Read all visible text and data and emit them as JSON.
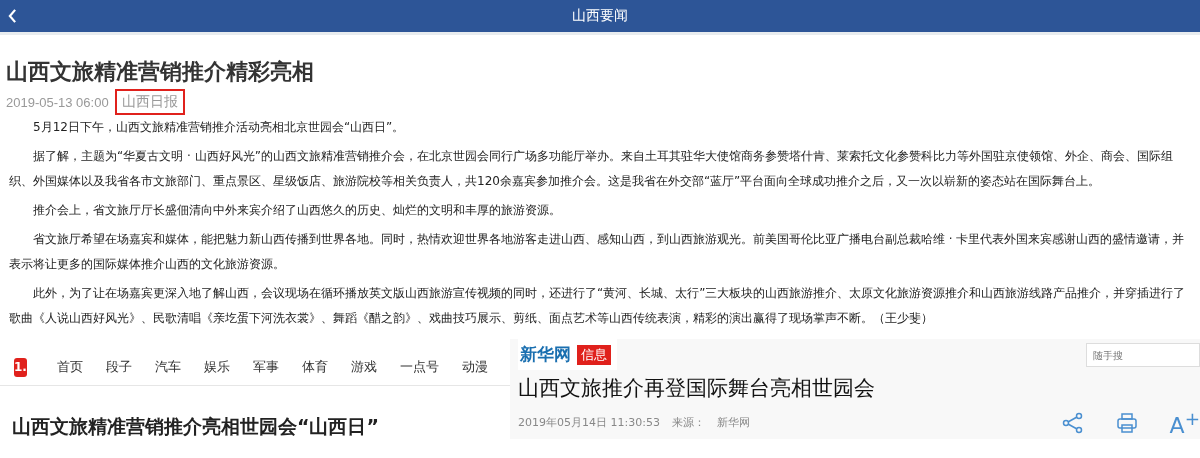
{
  "header": {
    "title": "山西要闻"
  },
  "article": {
    "title": "山西文旅精准营销推介精彩亮相",
    "date": "2019-05-13 06:00",
    "source": "山西日报",
    "source_highlighted": true,
    "paragraphs": [
      "5月12日下午，山西文旅精准营销推介活动亮相北京世园会“山西日”。",
      "据了解，主题为“华夏古文明 · 山西好风光”的山西文旅精准营销推介会，在北京世园会同行广场多功能厅举办。来自土耳其驻华大使馆商务参赞塔什肯、莱索托文化参赞科比力等外国驻京使领馆、外企、商会、国际组织、外国媒体以及我省各市文旅部门、重点景区、星级饭店、旅游院校等相关负责人，共120余嘉宾参加推介会。这是我省在外交部“蓝厅”平台面向全球成功推介之后，又一次以崭新的姿态站在国际舞台上。",
      "推介会上，省文旅厅厅长盛佃清向中外来宾介绍了山西悠久的历史、灿烂的文明和丰厚的旅游资源。",
      "省文旅厅希望在场嘉宾和媒体，能把魅力新山西传播到世界各地。同时，热情欢迎世界各地游客走进山西、感知山西，到山西旅游观光。前美国哥伦比亚广播电台副总裁哈维 · 卡里代表外国来宾感谢山西的盛情邀请，并表示将让更多的国际媒体推介山西的文化旅游资源。",
      "此外，为了让在场嘉宾更深入地了解山西，会议现场在循环播放英文版山西旅游宣传视频的同时，还进行了“黄河、长城、太行”三大板块的山西旅游推介、太原文化旅游资源推介和山西旅游线路产品推介，并穿插进行了歌曲《人说山西好风光》、民歌清唱《亲圪蛋下河洗衣裳》、舞蹈《醋之韵》、戏曲技巧展示、剪纸、面点艺术等山西传统表演，精彩的演出赢得了现场掌声不断。（王少斐）"
    ]
  },
  "left_page": {
    "logo": "1.",
    "nav": [
      "首页",
      "段子",
      "汽车",
      "娱乐",
      "军事",
      "体育",
      "游戏",
      "一点号",
      "动漫"
    ],
    "headline": "山西文旅精准营销推介亮相世园会“山西日”"
  },
  "right_page": {
    "logo": "新华网",
    "tag": "信息",
    "search": {
      "placeholder": "随手搜"
    },
    "headline": "山西文旅推介再登国际舞台亮相世园会",
    "date": "2019年05月14日 11:30:53",
    "source_label": "来源：",
    "source": "新华网",
    "font_button": "A$^{+}$"
  }
}
